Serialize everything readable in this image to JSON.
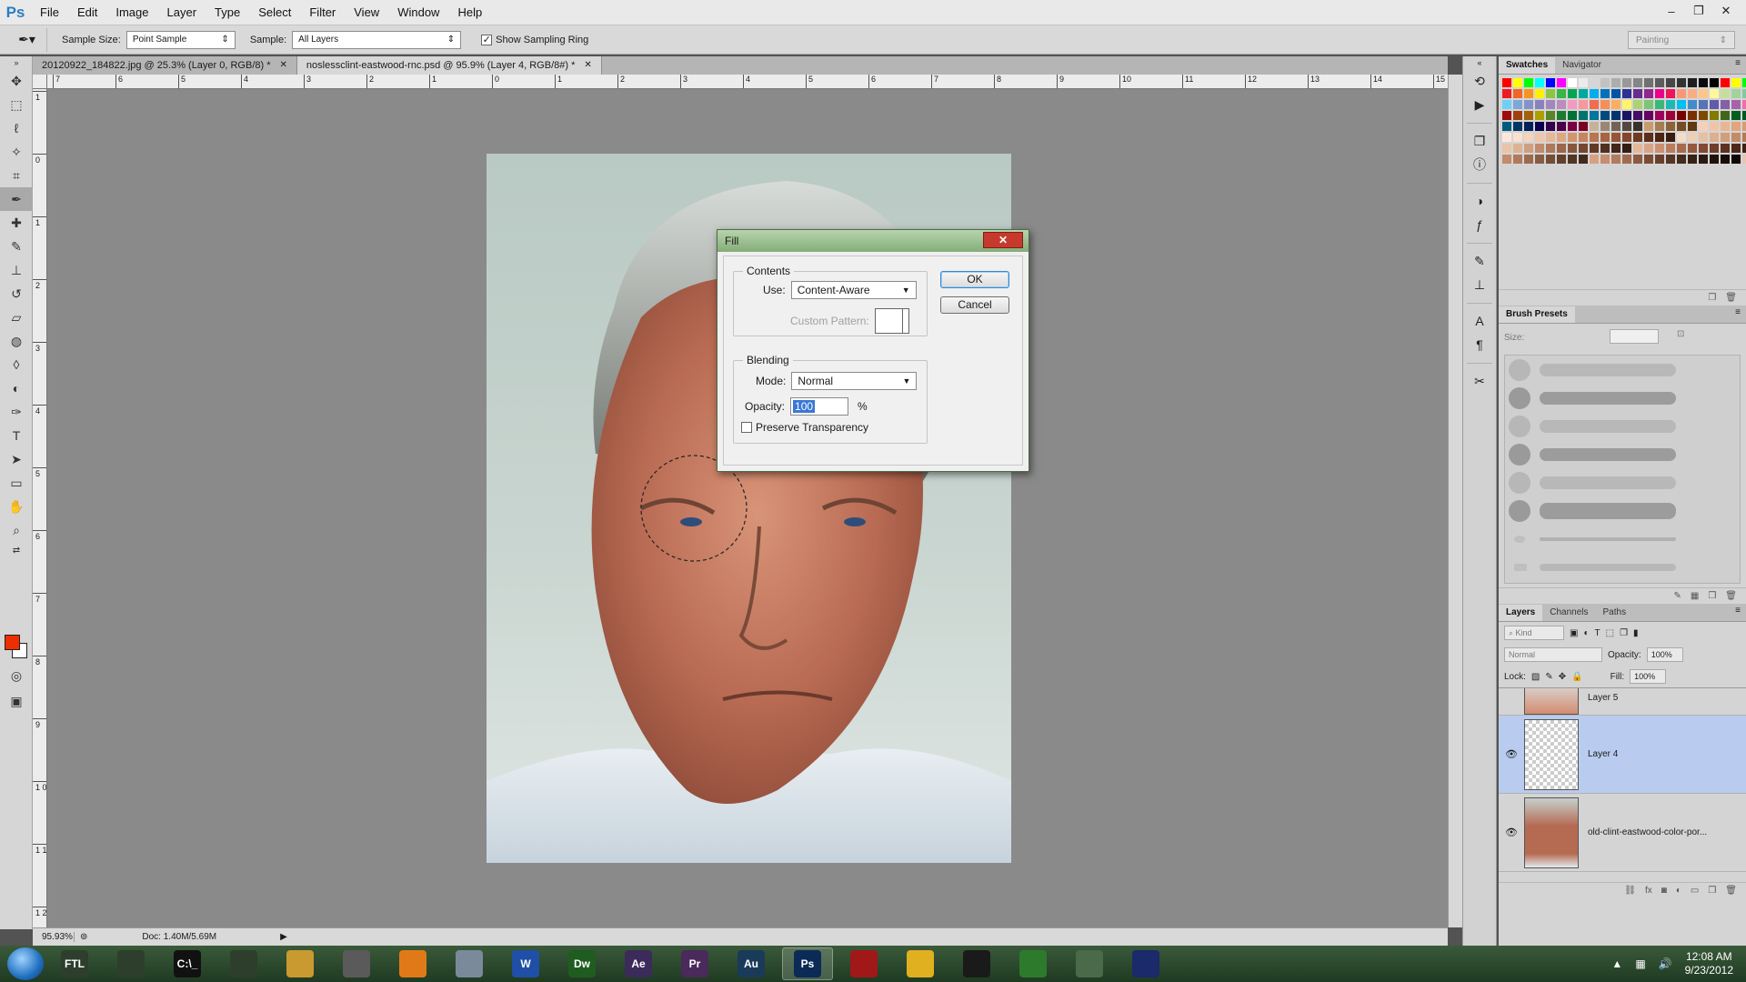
{
  "app": {
    "logo": "Ps"
  },
  "menu": [
    "File",
    "Edit",
    "Image",
    "Layer",
    "Type",
    "Select",
    "Filter",
    "View",
    "Window",
    "Help"
  ],
  "window_controls": {
    "minimize": "–",
    "restore": "❐",
    "close": "✕"
  },
  "options": {
    "sample_size_label": "Sample Size:",
    "sample_size_value": "Point Sample",
    "sample_label": "Sample:",
    "sample_value": "All Layers",
    "show_sampling_ring": "Show Sampling Ring",
    "workspace": "Painting"
  },
  "tabs": [
    {
      "label": "20120922_184822.jpg @ 25.3% (Layer 0, RGB/8) *",
      "active": false
    },
    {
      "label": "noslessclint-eastwood-rnc.psd @ 95.9% (Layer 4, RGB/8#) *",
      "active": true
    }
  ],
  "ruler_h": [
    "7",
    "6",
    "5",
    "4",
    "3",
    "2",
    "1",
    "0",
    "1",
    "2",
    "3",
    "4",
    "5",
    "6",
    "7",
    "8",
    "9",
    "10",
    "11",
    "12",
    "13",
    "14",
    "15"
  ],
  "ruler_v": [
    "1",
    "0",
    "1",
    "2",
    "3",
    "4",
    "5",
    "6",
    "7",
    "8",
    "9",
    "1 0",
    "1 1",
    "1 2"
  ],
  "status": {
    "zoom": "95.93%",
    "doc": "Doc: 1.40M/5.69M"
  },
  "dialog": {
    "title": "Fill",
    "contents_label": "Contents",
    "use_label": "Use:",
    "use_value": "Content-Aware",
    "custom_pattern_label": "Custom Pattern:",
    "blending_label": "Blending",
    "mode_label": "Mode:",
    "mode_value": "Normal",
    "opacity_label": "Opacity:",
    "opacity_value": "100",
    "opacity_unit": "%",
    "preserve_label": "Preserve Transparency",
    "ok": "OK",
    "cancel": "Cancel"
  },
  "panels": {
    "swatches_tab": "Swatches",
    "navigator_tab": "Navigator",
    "brush_presets_tab": "Brush Presets",
    "size_label": "Size:",
    "layers_tab": "Layers",
    "channels_tab": "Channels",
    "paths_tab": "Paths",
    "kind_filter": "Kind",
    "blend_mode": "Normal",
    "opacity_label": "Opacity:",
    "opacity_value": "100%",
    "lock_label": "Lock:",
    "fill_label": "Fill:",
    "fill_value": "100%",
    "layers": [
      {
        "name": "Layer 5",
        "selected": false
      },
      {
        "name": "Layer 4",
        "selected": true
      },
      {
        "name": "old-clint-eastwood-color-por...",
        "selected": false
      }
    ]
  },
  "taskbar": {
    "apps": [
      "FTL",
      "",
      "C:\\_",
      "",
      "",
      "",
      "",
      "",
      "W",
      "Dw",
      "Ae",
      "Pr",
      "Au",
      "Ps",
      "",
      "",
      "",
      "",
      "",
      ""
    ],
    "time": "12:08 AM",
    "date": "9/23/2012"
  },
  "colors": {
    "foreground": "#ec2e00",
    "background": "#ffffff",
    "selection_highlight": "#b9cbef"
  }
}
